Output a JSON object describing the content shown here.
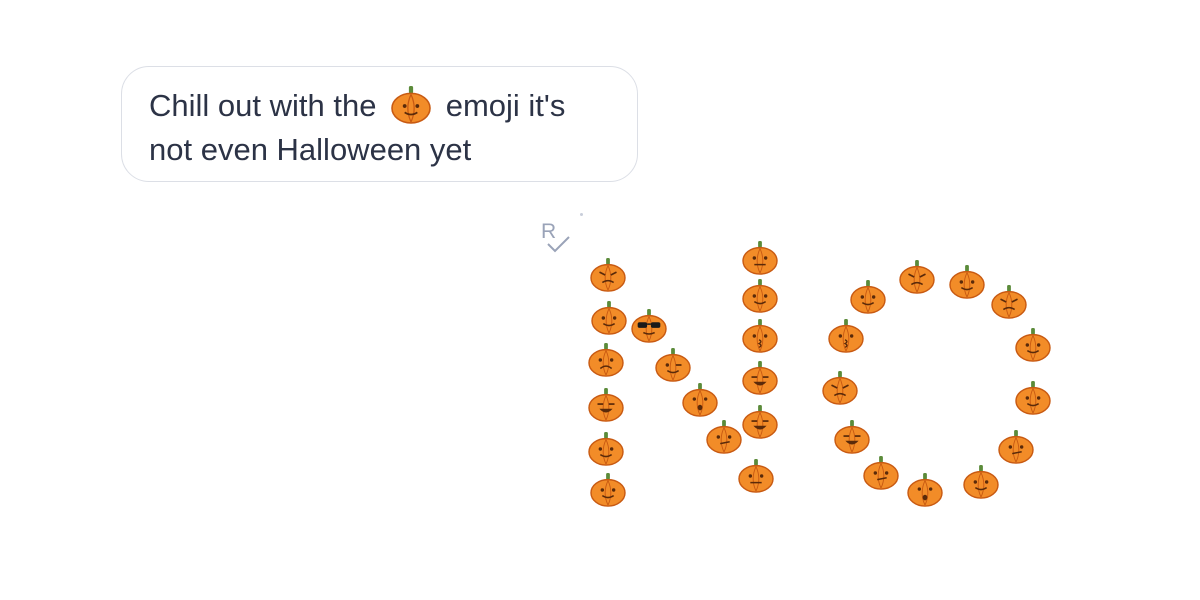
{
  "message": {
    "line1_before": "Chill out with the",
    "line1_emoji": "pumpkin-icon",
    "line1_after": "emoji it's",
    "line2": "not even Halloween yet"
  },
  "read_receipt": {
    "letter": "R",
    "icon": "checkmark-icon"
  },
  "reply_art": {
    "word_shape": "NO",
    "emoji": "pumpkin-icon",
    "colors": {
      "pumpkin": "#f28c28",
      "pumpkin_dark": "#c85a12",
      "stem": "#5b8b3a",
      "face": "#5a2a0a",
      "sunglasses": "#1a1a1a"
    }
  }
}
